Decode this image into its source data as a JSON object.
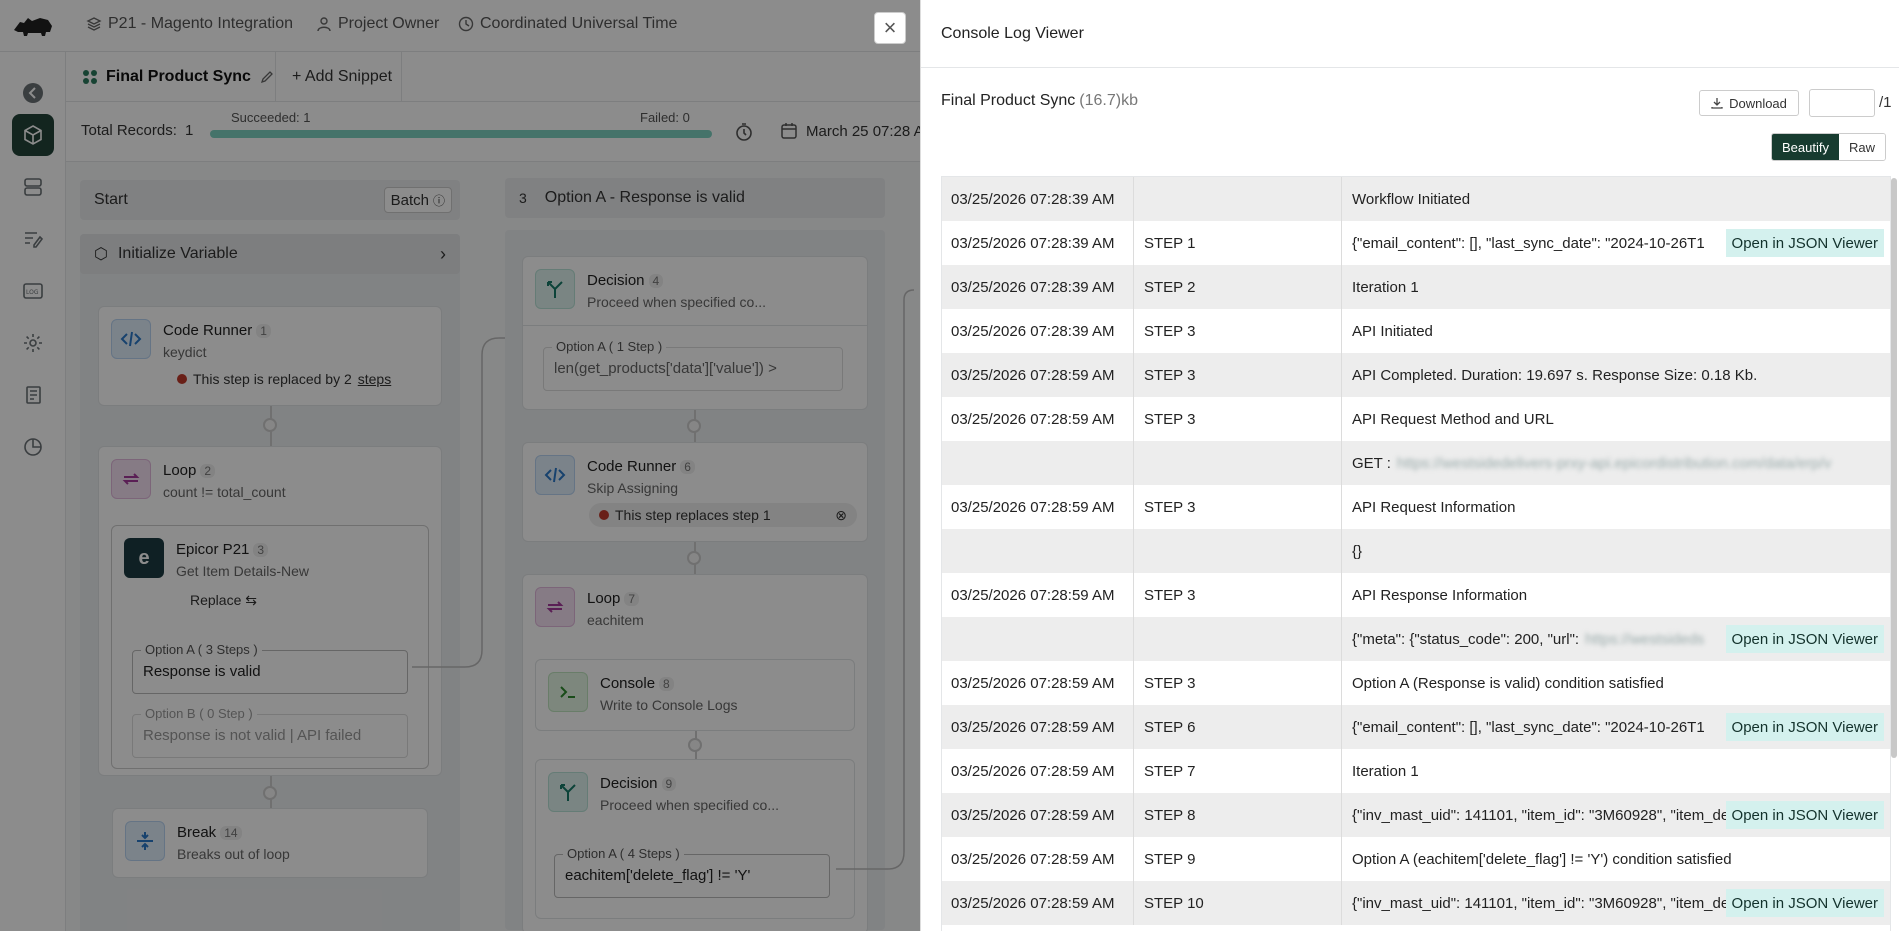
{
  "app": {
    "project": "P21 - Magento Integration",
    "owner": "Project Owner",
    "timezone": "Coordinated Universal Time",
    "active_tab": "Final Product Sync",
    "add_snippet": "+ Add Snippet",
    "total_records_label": "Total Records:",
    "total_records": "1",
    "succeeded": "Succeeded: 1",
    "failed": "Failed: 0",
    "progress_fraction": 1.0,
    "date": "March 25 07:28 A",
    "col1": {
      "header": "Start",
      "batch": "Batch",
      "init": "Initialize Variable",
      "code_runner": {
        "title": "Code Runner",
        "num": "1",
        "sub": "keydict",
        "note": "This step is replaced by 2",
        "note_link": "steps"
      },
      "loop": {
        "title": "Loop",
        "num": "2",
        "sub": "count != total_count"
      },
      "epicor": {
        "title": "Epicor P21",
        "num": "3",
        "sub": "Get Item Details-New",
        "replace": "Replace"
      },
      "optA": {
        "label": "Option A ( 3 Steps )",
        "value": "Response is valid"
      },
      "optB": {
        "label": "Option B ( 0 Step )",
        "value": "Response is not valid | API failed"
      },
      "break": {
        "title": "Break",
        "num": "14",
        "sub": "Breaks out of loop"
      }
    },
    "col2": {
      "header_num": "3",
      "header": "Option A - Response is valid",
      "decision": {
        "title": "Decision",
        "num": "4",
        "sub": "Proceed when specified co..."
      },
      "decision_opt": {
        "label": "Option A ( 1 Step )",
        "value": "len(get_products['data']['value']) >"
      },
      "code_runner": {
        "title": "Code Runner",
        "num": "6",
        "sub": "Skip Assigning",
        "note": "This step replaces step 1"
      },
      "loop": {
        "title": "Loop",
        "num": "7",
        "sub": "eachitem"
      },
      "console": {
        "title": "Console",
        "num": "8",
        "sub": "Write to Console Logs"
      },
      "decision2": {
        "title": "Decision",
        "num": "9",
        "sub": "Proceed when specified co..."
      },
      "decision2_opt": {
        "label": "Option A ( 4 Steps )",
        "value": "eachitem['delete_flag'] != 'Y'"
      }
    }
  },
  "drawer": {
    "title": "Console Log Viewer",
    "file_name": "Final Product Sync",
    "file_size": "(16.7)kb",
    "download": "Download",
    "page_total": "/1",
    "beautify": "Beautify",
    "raw": "Raw",
    "json_button": "Open in JSON Viewer",
    "rows": [
      {
        "time": "03/25/2026 07:28:39 AM",
        "step": "",
        "msg": "Workflow Initiated",
        "json": false
      },
      {
        "time": "03/25/2026 07:28:39 AM",
        "step": "STEP 1",
        "msg": "{\"email_content\": [], \"last_sync_date\": \"2024-10-26T1",
        "json": true
      },
      {
        "time": "03/25/2026 07:28:39 AM",
        "step": "STEP 2",
        "msg": "Iteration 1",
        "json": false
      },
      {
        "time": "03/25/2026 07:28:39 AM",
        "step": "STEP 3",
        "msg": "API Initiated",
        "json": false
      },
      {
        "time": "03/25/2026 07:28:59 AM",
        "step": "STEP 3",
        "msg": "API Completed. Duration: 19.697 s. Response Size: 0.18 Kb.",
        "json": false
      },
      {
        "time": "03/25/2026 07:28:59 AM",
        "step": "STEP 3",
        "msg": "API Request Method and URL",
        "json": false
      },
      {
        "time": "",
        "step": "",
        "msg": "GET :",
        "blur": "https://westsidedelivers-prxy-api.epicordistribution.com/data/erp/v",
        "json": false
      },
      {
        "time": "03/25/2026 07:28:59 AM",
        "step": "STEP 3",
        "msg": "API Request Information",
        "json": false
      },
      {
        "time": "",
        "step": "",
        "msg": "{}",
        "json": false
      },
      {
        "time": "03/25/2026 07:28:59 AM",
        "step": "STEP 3",
        "msg": "API Response Information",
        "json": false
      },
      {
        "time": "",
        "step": "",
        "msg": "{\"meta\": {\"status_code\": 200, \"url\":",
        "blur": "https://westsideds",
        "json": true
      },
      {
        "time": "03/25/2026 07:28:59 AM",
        "step": "STEP 3",
        "msg": "Option A (Response is valid) condition satisfied",
        "json": false
      },
      {
        "time": "03/25/2026 07:28:59 AM",
        "step": "STEP 6",
        "msg": "{\"email_content\": [], \"last_sync_date\": \"2024-10-26T1",
        "json": true
      },
      {
        "time": "03/25/2026 07:28:59 AM",
        "step": "STEP 7",
        "msg": "Iteration 1",
        "json": false
      },
      {
        "time": "03/25/2026 07:28:59 AM",
        "step": "STEP 8",
        "msg": "{\"inv_mast_uid\": 141101, \"item_id\": \"3M60928\", \"item_de",
        "json": true
      },
      {
        "time": "03/25/2026 07:28:59 AM",
        "step": "STEP 9",
        "msg": "Option A (eachitem['delete_flag'] != 'Y') condition satisfied",
        "json": false
      },
      {
        "time": "03/25/2026 07:28:59 AM",
        "step": "STEP 10",
        "msg": "{\"inv_mast_uid\": 141101, \"item_id\": \"3M60928\", \"item_de",
        "json": true
      }
    ]
  }
}
